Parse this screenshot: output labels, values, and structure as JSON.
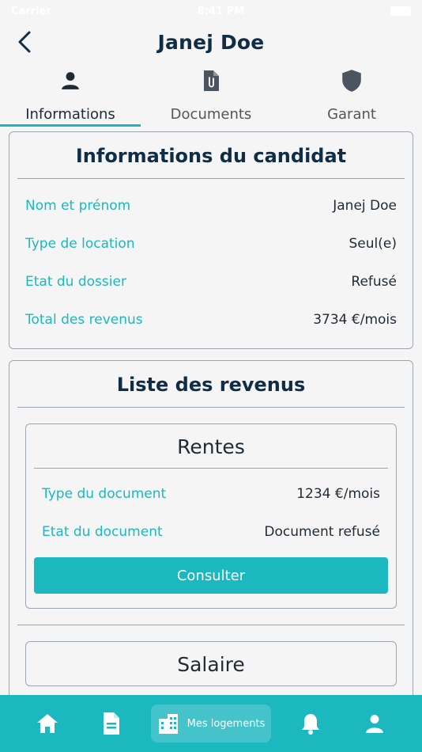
{
  "status_bar": {
    "carrier": "Carrier",
    "time": "8:41 PM"
  },
  "header": {
    "title": "Janej Doe"
  },
  "tabs": [
    {
      "label": "Informations",
      "icon": "person-icon",
      "active": true
    },
    {
      "label": "Documents",
      "icon": "document-clip-icon",
      "active": false
    },
    {
      "label": "Garant",
      "icon": "shield-icon",
      "active": false
    }
  ],
  "candidate": {
    "title": "Informations du candidat",
    "rows": [
      {
        "key": "Nom et prénom",
        "value": "Janej Doe"
      },
      {
        "key": "Type de location",
        "value": "Seul(e)"
      },
      {
        "key": "Etat du dossier",
        "value": "Refusé"
      },
      {
        "key": "Total des revenus",
        "value": "3734 €/mois"
      }
    ]
  },
  "revenues": {
    "title": "Liste des revenus",
    "items": [
      {
        "title": "Rentes",
        "rows": [
          {
            "key": "Type du document",
            "value": "1234 €/mois"
          },
          {
            "key": "Etat du document",
            "value": "Document refusé"
          }
        ],
        "button": "Consulter"
      },
      {
        "title": "Salaire"
      }
    ]
  },
  "bottom_nav": {
    "active_label": "Mes logements",
    "items": [
      "home-icon",
      "file-icon",
      "building-icon",
      "bell-icon",
      "user-icon"
    ]
  },
  "colors": {
    "accent": "#1bb8bf",
    "title": "#0f2d45",
    "border": "#9aa6b2"
  }
}
